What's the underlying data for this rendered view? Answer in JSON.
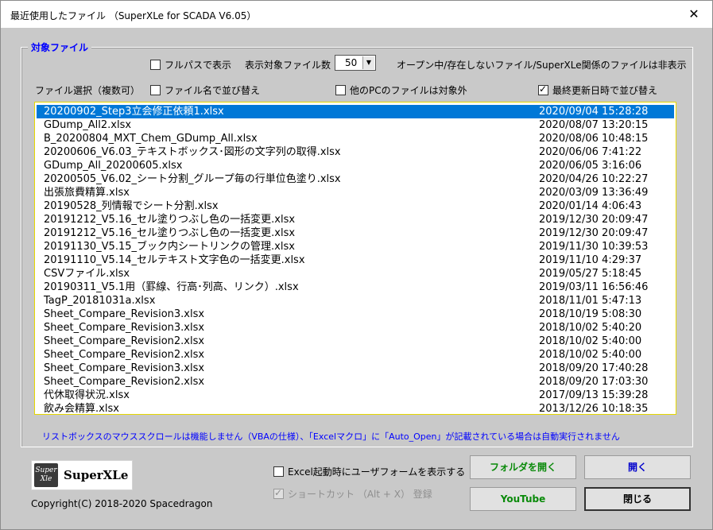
{
  "window": {
    "title": "最近使用したファイル （SuperXLe for SCADA V6.05）",
    "close_label": "✕"
  },
  "group": {
    "legend": "対象ファイル"
  },
  "options": {
    "full_path": {
      "label": "フルパスで表示",
      "checked": false
    },
    "file_count_label": "表示対象ファイル数",
    "file_count_value": "50",
    "hidden_note": "オープン中/存在しないファイル/SuperXLe関係のファイルは非表示",
    "select_label": "ファイル選択（複数可）",
    "sort_by_name": {
      "label": "ファイル名で並び替え",
      "checked": false
    },
    "exclude_other_pc": {
      "label": "他のPCのファイルは対象外",
      "checked": false
    },
    "sort_by_date": {
      "label": "最終更新日時で並び替え",
      "checked": true
    }
  },
  "files": [
    {
      "name": "20200902_Step3立会修正依頼1.xlsx",
      "date": "2020/09/04 15:28:28",
      "selected": true
    },
    {
      "name": "GDump_All2.xlsx",
      "date": "2020/08/07 13:20:15"
    },
    {
      "name": "B_20200804_MXT_Chem_GDump_All.xlsx",
      "date": "2020/08/06 10:48:15"
    },
    {
      "name": "20200606_V6.03_テキストボックス･図形の文字列の取得.xlsx",
      "date": "2020/06/06 7:41:22"
    },
    {
      "name": "GDump_All_20200605.xlsx",
      "date": "2020/06/05 3:16:06"
    },
    {
      "name": "20200505_V6.02_シート分割_グループ毎の行単位色塗り.xlsx",
      "date": "2020/04/26 10:22:27"
    },
    {
      "name": "出張旅費精算.xlsx",
      "date": "2020/03/09 13:36:49"
    },
    {
      "name": "20190528_列情報でシート分割.xlsx",
      "date": "2020/01/14 4:06:43"
    },
    {
      "name": "20191212_V5.16_セル塗りつぶし色の一括変更.xlsx",
      "date": "2019/12/30 20:09:47"
    },
    {
      "name": "20191212_V5.16_セル塗りつぶし色の一括変更.xlsx",
      "date": "2019/12/30 20:09:47"
    },
    {
      "name": "20191130_V5.15_ブック内シートリンクの管理.xlsx",
      "date": "2019/11/30 10:39:53"
    },
    {
      "name": "20191110_V5.14_セルテキスト文字色の一括変更.xlsx",
      "date": "2019/11/10 4:29:37"
    },
    {
      "name": "CSVファイル.xlsx",
      "date": "2019/05/27 5:18:45"
    },
    {
      "name": "20190311_V5.1用（罫線、行高･列高、リンク）.xlsx",
      "date": "2019/03/11 16:56:46"
    },
    {
      "name": "TagP_20181031a.xlsx",
      "date": "2018/11/01 5:47:13"
    },
    {
      "name": "Sheet_Compare_Revision3.xlsx",
      "date": "2018/10/19 5:08:30"
    },
    {
      "name": "Sheet_Compare_Revision3.xlsx",
      "date": "2018/10/02 5:40:20"
    },
    {
      "name": "Sheet_Compare_Revision2.xlsx",
      "date": "2018/10/02 5:40:00"
    },
    {
      "name": "Sheet_Compare_Revision2.xlsx",
      "date": "2018/10/02 5:40:00"
    },
    {
      "name": "Sheet_Compare_Revision3.xlsx",
      "date": "2018/09/20 17:40:28"
    },
    {
      "name": "Sheet_Compare_Revision2.xlsx",
      "date": "2018/09/20 17:03:30"
    },
    {
      "name": "代休取得状況.xlsx",
      "date": "2017/09/13 15:39:28"
    },
    {
      "name": "飲み会精算.xlsx",
      "date": "2013/12/26 10:18:35"
    }
  ],
  "note": "リストボックスのマウススクロールは機能しません（VBAの仕様）、「Excelマクロ」に「Auto_Open」が記載されている場合は自動実行されません",
  "footer": {
    "logo_icon_top": "Super",
    "logo_icon_bottom": "Xle",
    "logo_text": "SuperXLe",
    "copyright": "Copyright(C) 2018-2020 Spacedragon",
    "show_userform": {
      "label": "Excel起動時にユーザフォームを表示する",
      "checked": false
    },
    "shortcut": {
      "label": "ショートカット （Alt + X） 登録",
      "checked": true,
      "disabled": true
    }
  },
  "buttons": {
    "open_folder": "フォルダを開く",
    "open": "開く",
    "youtube": "YouTube",
    "close": "閉じる"
  },
  "colors": {
    "accent_blue": "#0000ff",
    "selection": "#0078d7",
    "button_green": "#0a8a0a"
  }
}
